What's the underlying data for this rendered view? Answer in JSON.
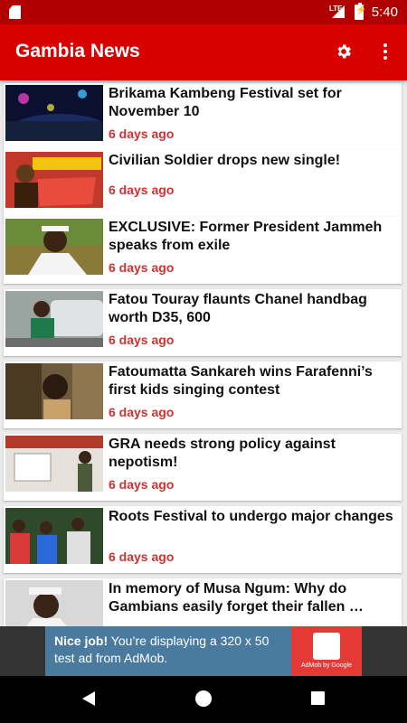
{
  "status_bar": {
    "network": "LTE",
    "time": "5:40"
  },
  "app_bar": {
    "title": "Gambia News",
    "settings_icon": "gear-icon",
    "more_icon": "more-vert-icon"
  },
  "colors": {
    "status_bar": "#b00000",
    "app_bar": "#d90000",
    "time_text": "#d23131"
  },
  "articles": [
    {
      "headline": "Brikama Kambeng Festival set for November 10",
      "time": "6 days ago"
    },
    {
      "headline": "Civilian Soldier drops new single!",
      "time": "6 days ago"
    },
    {
      "headline": "EXCLUSIVE: Former President Jammeh speaks from exile",
      "time": "6 days ago"
    },
    {
      "headline": "Fatou Touray flaunts Chanel handbag worth D35, 600",
      "time": "6 days ago"
    },
    {
      "headline": "Fatoumatta Sankareh wins Farafenni’s first kids singing contest",
      "time": "6 days ago"
    },
    {
      "headline": "GRA needs strong policy against nepotism!",
      "time": "6 days ago"
    },
    {
      "headline": "Roots Festival to undergo major changes",
      "time": "6 days ago"
    },
    {
      "headline": "In memory of Musa Ngum: Why do Gambians easily forget their fallen …",
      "time": ""
    }
  ],
  "ad": {
    "bold": "Nice job!",
    "text": " You’re displaying a 320 x 50 test ad from AdMob.",
    "logo_caption": "AdMob by Google"
  }
}
